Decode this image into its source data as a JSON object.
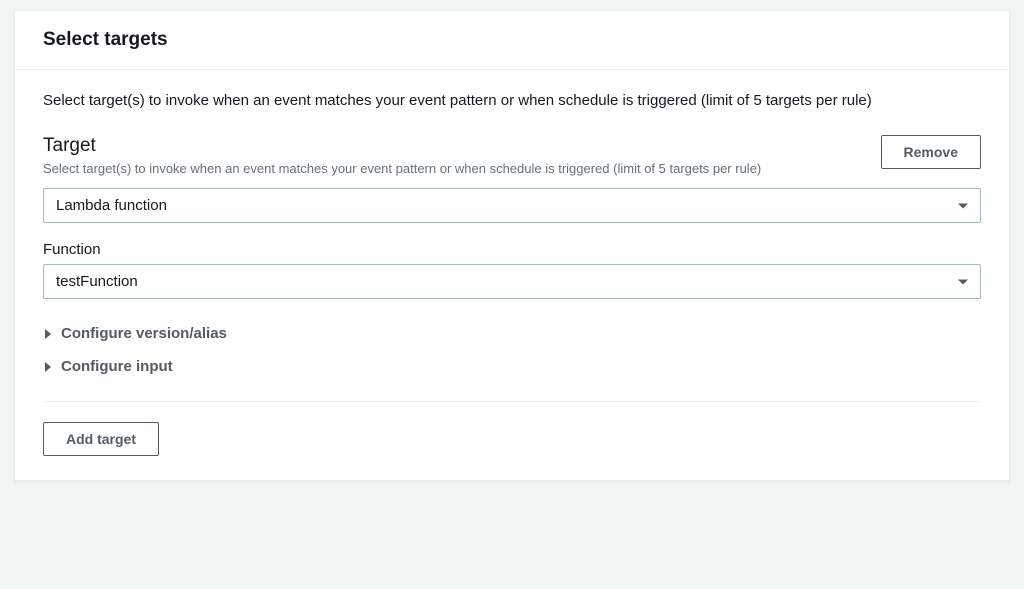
{
  "panel": {
    "title": "Select targets",
    "description": "Select target(s) to invoke when an event matches your event pattern or when schedule is triggered (limit of 5 targets per rule)"
  },
  "target": {
    "label": "Target",
    "help": "Select target(s) to invoke when an event matches your event pattern or when schedule is triggered (limit of 5 targets per rule)",
    "remove_label": "Remove",
    "type_value": "Lambda function",
    "function_label": "Function",
    "function_value": "testFunction"
  },
  "expandables": {
    "version_alias": "Configure version/alias",
    "input": "Configure input"
  },
  "actions": {
    "add_target": "Add target"
  }
}
